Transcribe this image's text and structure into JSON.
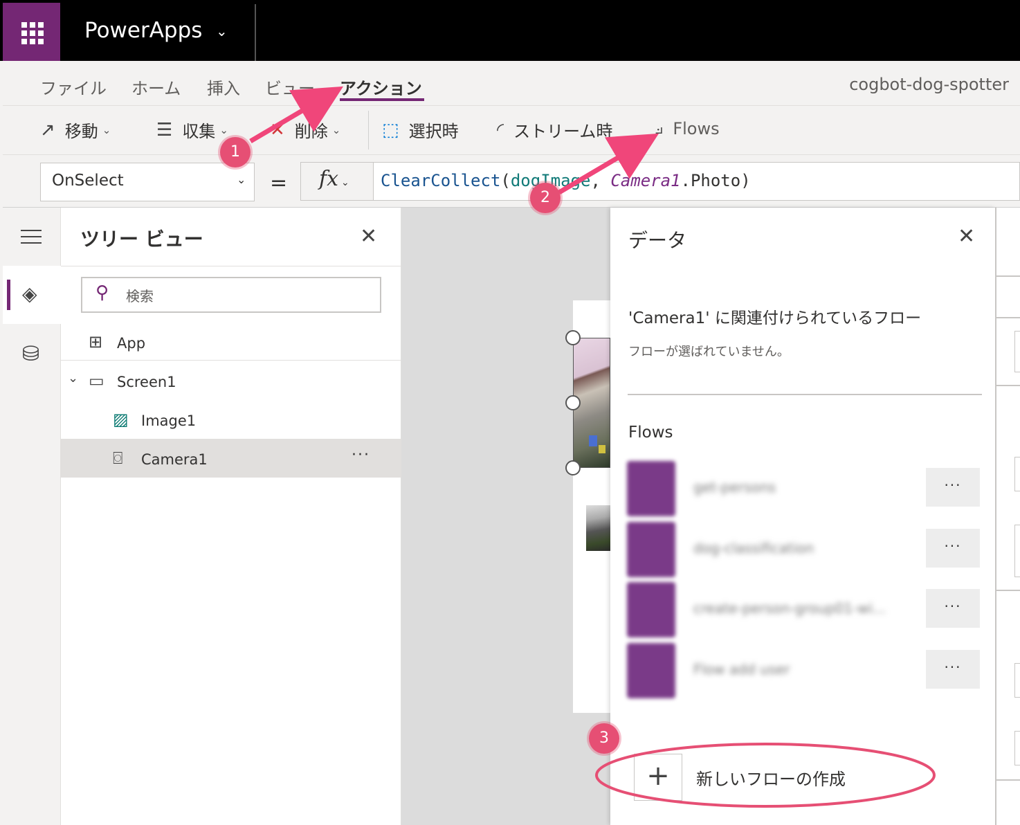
{
  "app": {
    "title": "PowerApps",
    "project_name": "cogbot-dog-spotter"
  },
  "menu": {
    "items": [
      "ファイル",
      "ホーム",
      "挿入",
      "ビュー",
      "アクション"
    ],
    "active": "アクション"
  },
  "commands": {
    "navigate": "移動",
    "collect": "収集",
    "remove": "削除",
    "on_select": "選択時",
    "on_stream": "ストリーム時",
    "flows": "Flows"
  },
  "formula": {
    "property": "OnSelect",
    "equals": "=",
    "fx": "fx",
    "fn": "ClearCollect",
    "open_paren": "(",
    "collection": "dogImage",
    "comma": ", ",
    "control": "Camera1",
    "rest": ".Photo)"
  },
  "tree": {
    "title": "ツリー ビュー",
    "search_placeholder": "検索",
    "nodes": [
      "App",
      "Screen1",
      "Image1",
      "Camera1"
    ],
    "more": "···"
  },
  "data_panel": {
    "title": "データ",
    "associated_title": "'Camera1' に関連付けられているフロー",
    "associated_empty": "フローが選ばれていません。",
    "flows_heading": "Flows",
    "flows": [
      {
        "name": "get-persons",
        "more": "···"
      },
      {
        "name": "dog-classification",
        "more": "···"
      },
      {
        "name": "create-person-group01-wi...",
        "more": "···"
      },
      {
        "name": "Flow add user",
        "more": "···"
      }
    ],
    "new_flow_label": "新しいフローの作成",
    "new_flow_icon": "+"
  },
  "annotations": {
    "badges": [
      "1",
      "2",
      "3"
    ],
    "color": "#e64f74"
  },
  "colors": {
    "brand": "#742774",
    "accent_underline": "#742774"
  }
}
